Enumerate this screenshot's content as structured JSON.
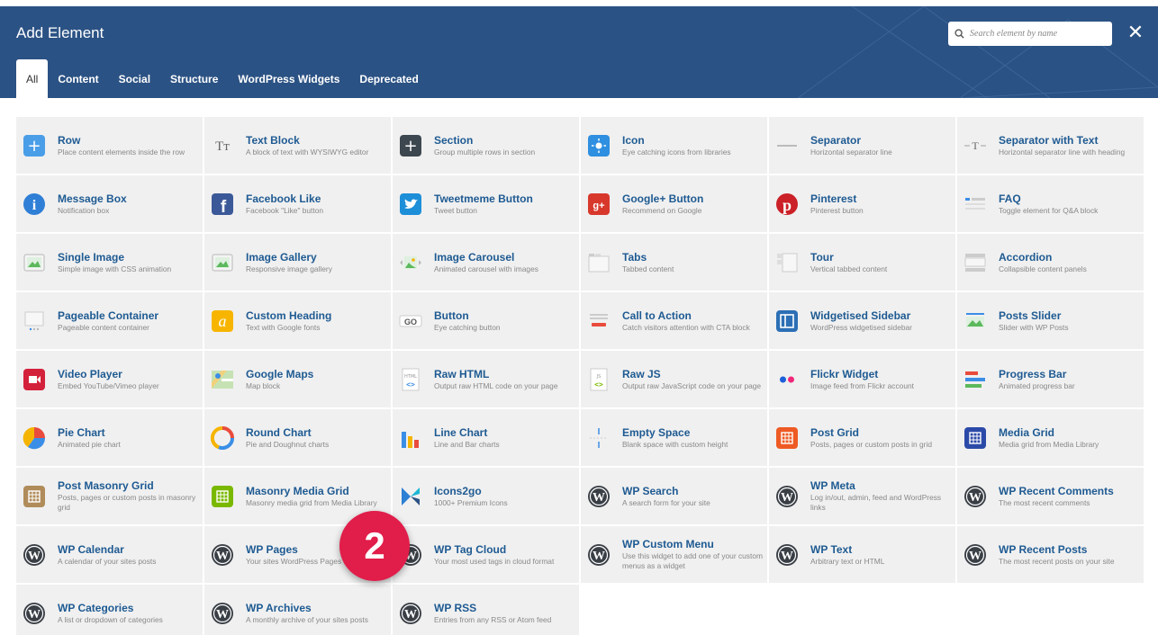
{
  "header": {
    "title": "Add Element",
    "search_placeholder": "Search element by name",
    "close_glyph": "✕",
    "colors": {
      "bg": "#2b5284",
      "text": "#ffffff"
    }
  },
  "tabs": [
    {
      "label": "All",
      "active": true
    },
    {
      "label": "Content",
      "active": false
    },
    {
      "label": "Social",
      "active": false
    },
    {
      "label": "Structure",
      "active": false
    },
    {
      "label": "WordPress Widgets",
      "active": false
    },
    {
      "label": "Deprecated",
      "active": false
    }
  ],
  "elements": [
    {
      "name": "Row",
      "desc": "Place content elements inside the row",
      "icon": "row-icon"
    },
    {
      "name": "Text Block",
      "desc": "A block of text with WYSIWYG editor",
      "icon": "text-block-icon"
    },
    {
      "name": "Section",
      "desc": "Group multiple rows in section",
      "icon": "section-icon"
    },
    {
      "name": "Icon",
      "desc": "Eye catching icons from libraries",
      "icon": "icon-icon"
    },
    {
      "name": "Separator",
      "desc": "Horizontal separator line",
      "icon": "separator-icon"
    },
    {
      "name": "Separator with Text",
      "desc": "Horizontal separator line with heading",
      "icon": "separator-text-icon"
    },
    {
      "name": "Message Box",
      "desc": "Notification box",
      "icon": "message-box-icon"
    },
    {
      "name": "Facebook Like",
      "desc": "Facebook \"Like\" button",
      "icon": "facebook-icon"
    },
    {
      "name": "Tweetmeme Button",
      "desc": "Tweet button",
      "icon": "twitter-icon"
    },
    {
      "name": "Google+ Button",
      "desc": "Recommend on Google",
      "icon": "google-plus-icon"
    },
    {
      "name": "Pinterest",
      "desc": "Pinterest button",
      "icon": "pinterest-icon"
    },
    {
      "name": "FAQ",
      "desc": "Toggle element for Q&A block",
      "icon": "faq-icon"
    },
    {
      "name": "Single Image",
      "desc": "Simple image with CSS animation",
      "icon": "single-image-icon"
    },
    {
      "name": "Image Gallery",
      "desc": "Responsive image gallery",
      "icon": "image-gallery-icon"
    },
    {
      "name": "Image Carousel",
      "desc": "Animated carousel with images",
      "icon": "image-carousel-icon"
    },
    {
      "name": "Tabs",
      "desc": "Tabbed content",
      "icon": "tabs-icon"
    },
    {
      "name": "Tour",
      "desc": "Vertical tabbed content",
      "icon": "tour-icon"
    },
    {
      "name": "Accordion",
      "desc": "Collapsible content panels",
      "icon": "accordion-icon"
    },
    {
      "name": "Pageable Container",
      "desc": "Pageable content container",
      "icon": "pageable-icon"
    },
    {
      "name": "Custom Heading",
      "desc": "Text with Google fonts",
      "icon": "custom-heading-icon"
    },
    {
      "name": "Button",
      "desc": "Eye catching button",
      "icon": "button-icon"
    },
    {
      "name": "Call to Action",
      "desc": "Catch visitors attention with CTA block",
      "icon": "cta-icon"
    },
    {
      "name": "Widgetised Sidebar",
      "desc": "WordPress widgetised sidebar",
      "icon": "sidebar-icon"
    },
    {
      "name": "Posts Slider",
      "desc": "Slider with WP Posts",
      "icon": "posts-slider-icon"
    },
    {
      "name": "Video Player",
      "desc": "Embed YouTube/Vimeo player",
      "icon": "video-icon"
    },
    {
      "name": "Google Maps",
      "desc": "Map block",
      "icon": "maps-icon"
    },
    {
      "name": "Raw HTML",
      "desc": "Output raw HTML code on your page",
      "icon": "raw-html-icon"
    },
    {
      "name": "Raw JS",
      "desc": "Output raw JavaScript code on your page",
      "icon": "raw-js-icon"
    },
    {
      "name": "Flickr Widget",
      "desc": "Image feed from Flickr account",
      "icon": "flickr-icon"
    },
    {
      "name": "Progress Bar",
      "desc": "Animated progress bar",
      "icon": "progress-bar-icon"
    },
    {
      "name": "Pie Chart",
      "desc": "Animated pie chart",
      "icon": "pie-chart-icon"
    },
    {
      "name": "Round Chart",
      "desc": "Pie and Doughnut charts",
      "icon": "round-chart-icon"
    },
    {
      "name": "Line Chart",
      "desc": "Line and Bar charts",
      "icon": "line-chart-icon"
    },
    {
      "name": "Empty Space",
      "desc": "Blank space with custom height",
      "icon": "empty-space-icon"
    },
    {
      "name": "Post Grid",
      "desc": "Posts, pages or custom posts in grid",
      "icon": "post-grid-icon"
    },
    {
      "name": "Media Grid",
      "desc": "Media grid from Media Library",
      "icon": "media-grid-icon"
    },
    {
      "name": "Post Masonry Grid",
      "desc": "Posts, pages or custom posts in masonry grid",
      "icon": "masonry-grid-icon"
    },
    {
      "name": "Masonry Media Grid",
      "desc": "Masonry media grid from Media Library",
      "icon": "masonry-media-icon"
    },
    {
      "name": "Icons2go",
      "desc": "1000+ Premium Icons",
      "icon": "icons2go-icon"
    },
    {
      "name": "WP Search",
      "desc": "A search form for your site",
      "icon": "wordpress-icon"
    },
    {
      "name": "WP Meta",
      "desc": "Log in/out, admin, feed and WordPress links",
      "icon": "wordpress-icon"
    },
    {
      "name": "WP Recent Comments",
      "desc": "The most recent comments",
      "icon": "wordpress-icon"
    },
    {
      "name": "WP Calendar",
      "desc": "A calendar of your sites posts",
      "icon": "wordpress-icon"
    },
    {
      "name": "WP Pages",
      "desc": "Your sites WordPress Pages",
      "icon": "wordpress-icon"
    },
    {
      "name": "WP Tag Cloud",
      "desc": "Your most used tags in cloud format",
      "icon": "wordpress-icon"
    },
    {
      "name": "WP Custom Menu",
      "desc": "Use this widget to add one of your custom menus as a widget",
      "icon": "wordpress-icon"
    },
    {
      "name": "WP Text",
      "desc": "Arbitrary text or HTML",
      "icon": "wordpress-icon"
    },
    {
      "name": "WP Recent Posts",
      "desc": "The most recent posts on your site",
      "icon": "wordpress-icon"
    },
    {
      "name": "WP Categories",
      "desc": "A list or dropdown of categories",
      "icon": "wordpress-icon"
    },
    {
      "name": "WP Archives",
      "desc": "A monthly archive of your sites posts",
      "icon": "wordpress-icon"
    },
    {
      "name": "WP RSS",
      "desc": "Entries from any RSS or Atom feed",
      "icon": "wordpress-icon"
    }
  ],
  "step_badge": "2"
}
